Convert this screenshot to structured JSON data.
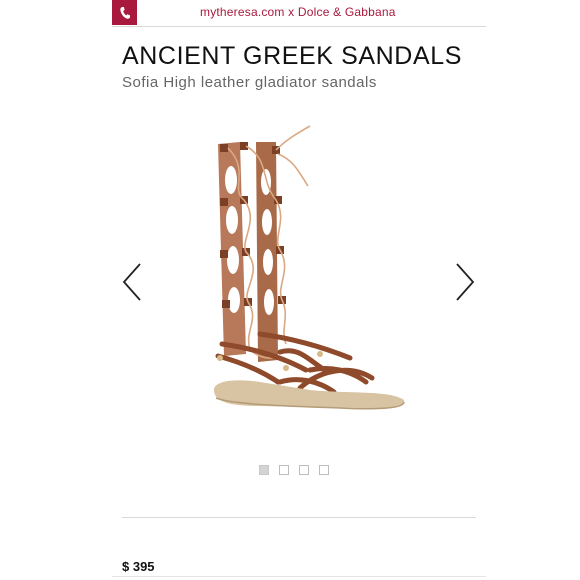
{
  "topbar": {
    "title": "mytheresa.com x Dolce & Gabbana",
    "phone_icon": "phone-icon",
    "accent_color": "#a8193d"
  },
  "product": {
    "brand": "ANCIENT GREEK SANDALS",
    "name": "Sofia High leather gladiator sandals",
    "price": "$ 395"
  },
  "gallery": {
    "image_count": 4,
    "active_index": 0,
    "prev_icon": "chevron-left-icon",
    "next_icon": "chevron-right-icon"
  }
}
